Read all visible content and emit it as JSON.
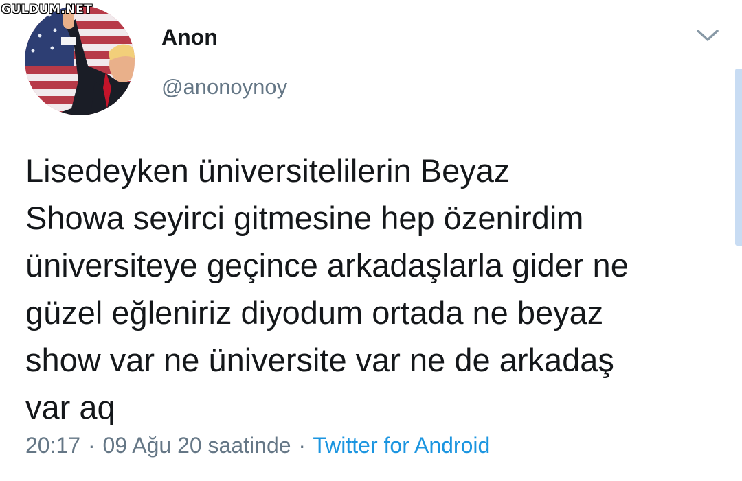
{
  "watermark": "GULDUM.NET",
  "tweet": {
    "author": {
      "display_name": "Anon",
      "handle": "@anonoynoy",
      "avatar_icon": "profile-photo"
    },
    "menu_icon": "chevron-down-icon",
    "text": "Lisedeyken üniversitelilerin Beyaz\nShowa seyirci gitmesine hep özenirdim\nüniversiteye geçince arkadaşlarla gider ne\ngüzel eğleniriz diyodum ortada ne beyaz\nshow var ne üniversite var ne de arkadaş\nvar aq",
    "meta": {
      "time": "20:17",
      "separator": "·",
      "date": "09 Ağu 20 saatinde",
      "source": "Twitter for Android"
    }
  },
  "colors": {
    "text_primary": "#14171a",
    "text_secondary": "#657786",
    "link_blue": "#1b95e0",
    "scrollbar": "#c8dcf3"
  }
}
